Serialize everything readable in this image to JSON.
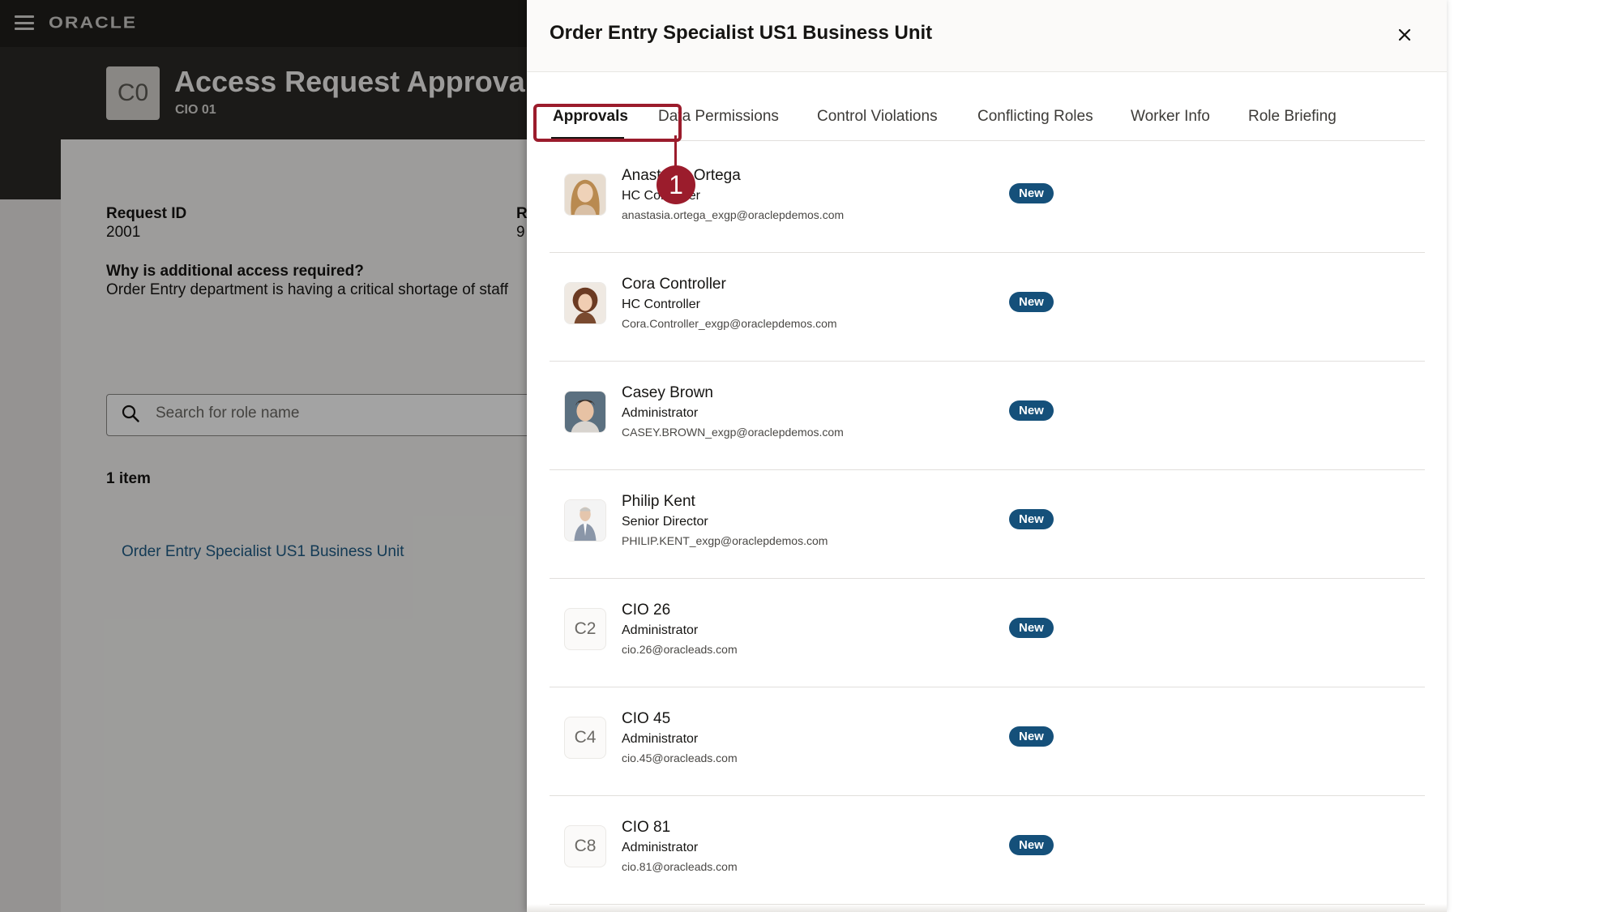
{
  "topbar": {
    "brand": "ORACLE"
  },
  "page": {
    "avatar_initials": "C0",
    "title": "Access Request Approvals",
    "subtitle": "CIO 01",
    "request_id_label": "Request ID",
    "request_id_value": "2001",
    "reason_label": "Why is additional access required?",
    "reason_value": "Order Entry department is having a critical shortage of staff",
    "right_label_fragment": "R",
    "right_value_fragment": "9",
    "search_placeholder": "Search for role name",
    "item_count": "1 item",
    "role_link": "Order Entry Specialist US1 Business Unit"
  },
  "drawer": {
    "title": "Order Entry Specialist US1 Business Unit",
    "close_icon": "close-icon",
    "tabs": [
      {
        "label": "Approvals",
        "active": true
      },
      {
        "label": "Data Permissions",
        "active": false
      },
      {
        "label": "Control Violations",
        "active": false
      },
      {
        "label": "Conflicting Roles",
        "active": false
      },
      {
        "label": "Worker Info",
        "active": false
      },
      {
        "label": "Role Briefing",
        "active": false
      }
    ],
    "callout_number": "1",
    "callout_color": "#9b1c2c",
    "badge_color": "#15507a",
    "approvers": [
      {
        "name": "Anastasia Ortega",
        "role": "HC Controller",
        "email": "anastasia.ortega_exgp@oraclepdemos.com",
        "status": "New",
        "avatar": "photo"
      },
      {
        "name": "Cora Controller",
        "role": "HC Controller",
        "email": "Cora.Controller_exgp@oraclepdemos.com",
        "status": "New",
        "avatar": "photo"
      },
      {
        "name": "Casey Brown",
        "role": "Administrator",
        "email": "CASEY.BROWN_exgp@oraclepdemos.com",
        "status": "New",
        "avatar": "photo"
      },
      {
        "name": "Philip Kent",
        "role": "Senior Director",
        "email": "PHILIP.KENT_exgp@oraclepdemos.com",
        "status": "New",
        "avatar": "photo"
      },
      {
        "name": "CIO 26",
        "role": "Administrator",
        "email": "cio.26@oracleads.com",
        "status": "New",
        "avatar": "C2"
      },
      {
        "name": "CIO 45",
        "role": "Administrator",
        "email": "cio.45@oracleads.com",
        "status": "New",
        "avatar": "C4"
      },
      {
        "name": "CIO 81",
        "role": "Administrator",
        "email": "cio.81@oracleads.com",
        "status": "New",
        "avatar": "C8"
      }
    ]
  }
}
